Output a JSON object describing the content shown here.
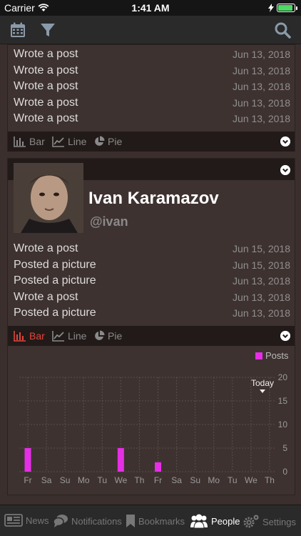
{
  "status": {
    "carrier": "Carrier",
    "time": "1:41 AM"
  },
  "toolbar": {
    "calendar_icon": "calendar-icon",
    "filter_icon": "filter-icon",
    "search_icon": "search-icon"
  },
  "card1": {
    "activities": [
      {
        "what": "Wrote a post",
        "when": "Jun 13, 2018"
      },
      {
        "what": "Wrote a post",
        "when": "Jun 13, 2018"
      },
      {
        "what": "Wrote a post",
        "when": "Jun 13, 2018"
      },
      {
        "what": "Wrote a post",
        "when": "Jun 13, 2018"
      },
      {
        "what": "Wrote a post",
        "when": "Jun 13, 2018"
      }
    ],
    "chart_options": [
      "Bar",
      "Line",
      "Pie"
    ],
    "active_option": "none"
  },
  "card2": {
    "name": "Ivan Karamazov",
    "handle": "@ivan",
    "activities": [
      {
        "what": "Wrote a post",
        "when": "Jun 15, 2018"
      },
      {
        "what": "Posted a picture",
        "when": "Jun 15, 2018"
      },
      {
        "what": "Posted a picture",
        "when": "Jun 13, 2018"
      },
      {
        "what": "Wrote a post",
        "when": "Jun 13, 2018"
      },
      {
        "what": "Posted a picture",
        "when": "Jun 13, 2018"
      }
    ],
    "chart_options": [
      "Bar",
      "Line",
      "Pie"
    ],
    "active_option": "Bar"
  },
  "chart_data": {
    "type": "bar",
    "categories": [
      "Fr",
      "Sa",
      "Su",
      "Mo",
      "Tu",
      "We",
      "Th",
      "Fr",
      "Sa",
      "Su",
      "Mo",
      "Tu",
      "We",
      "Th"
    ],
    "series": [
      {
        "name": "Posts",
        "values": [
          5,
          0,
          0,
          0,
          0,
          5,
          0,
          2,
          0,
          0,
          0,
          0,
          0,
          0
        ],
        "color": "#e62ee6"
      }
    ],
    "yticks": [
      "0",
      "5",
      "10",
      "15",
      "20"
    ],
    "ylim": [
      0,
      20
    ],
    "annotation": "Today",
    "legend_position": "top-right",
    "grid": true
  },
  "tabs": [
    {
      "label": "News",
      "icon": "news-icon"
    },
    {
      "label": "Notifications",
      "icon": "notifications-icon"
    },
    {
      "label": "Bookmarks",
      "icon": "bookmark-icon"
    },
    {
      "label": "People",
      "icon": "people-icon"
    },
    {
      "label": "Settings",
      "icon": "settings-icon"
    }
  ],
  "active_tab": "People",
  "colors": {
    "accent": "#e0453a",
    "series": "#e62ee6",
    "background": "#3a2f2d"
  }
}
